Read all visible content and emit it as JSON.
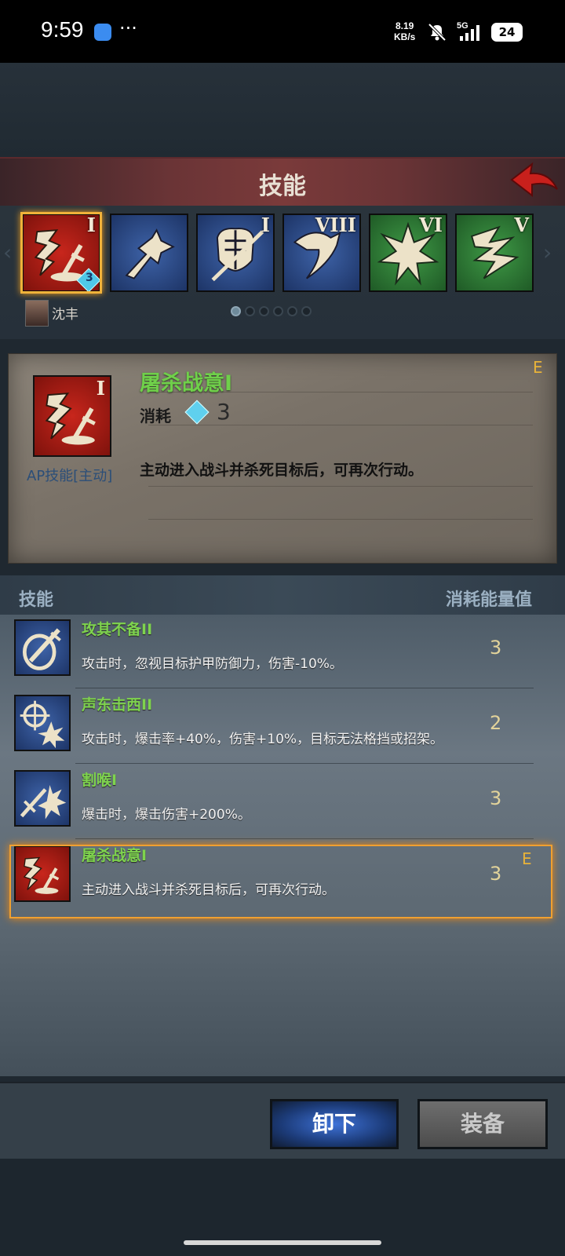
{
  "status_bar": {
    "time": "9:59",
    "dots": "···",
    "net_speed_value": "8.19",
    "net_speed_unit": "KB/s",
    "network": "5G",
    "battery": "24"
  },
  "header": {
    "title": "技能"
  },
  "skill_strip": {
    "tiles": [
      {
        "numeral": "I",
        "color": "red",
        "icon": "kill-sword-icon",
        "gem_count": "3"
      },
      {
        "numeral": "",
        "color": "blue",
        "icon": "dash-arrow-icon"
      },
      {
        "numeral": "I",
        "color": "blue",
        "icon": "armor-sword-icon"
      },
      {
        "numeral": "VIII",
        "color": "blue",
        "icon": "swoop-claw-icon"
      },
      {
        "numeral": "VI",
        "color": "green",
        "icon": "burst-icon"
      },
      {
        "numeral": "V",
        "color": "green",
        "icon": "slash-claw-icon"
      }
    ],
    "hero_name": "沈丰",
    "page_count": 6,
    "current_page": 1
  },
  "detail": {
    "name": "屠杀战意I",
    "cost_label": "消耗",
    "cost_value": "3",
    "type": "AP技能[主动]",
    "description": "主动进入战斗并杀死目标后，可再次行动。",
    "badge": "E"
  },
  "list": {
    "header_left": "技能",
    "header_right": "消耗能量值",
    "rows": [
      {
        "name": "攻其不备II",
        "description": "攻击时，忽视目标护甲防御力，伤害-10%。",
        "cost": "3",
        "icon": "shield-pierce-icon"
      },
      {
        "name": "声东击西II",
        "description": "攻击时，爆击率+40%，伤害+10%，目标无法格挡或招架。",
        "cost": "2",
        "icon": "crosshair-burst-icon"
      },
      {
        "name": "割喉I",
        "description": "爆击时，爆击伤害+200%。",
        "cost": "3",
        "icon": "blade-burst-icon"
      },
      {
        "name": "屠杀战意I",
        "description": "主动进入战斗并杀死目标后，可再次行动。",
        "cost": "3",
        "icon": "kill-sword-icon",
        "badge": "E",
        "equipped": true
      }
    ]
  },
  "buttons": {
    "unequip": "卸下",
    "equip": "装备"
  },
  "colors": {
    "accent_green": "#7ed34e",
    "highlight_orange": "#f0a030",
    "primary_button": "#3e72d8"
  }
}
